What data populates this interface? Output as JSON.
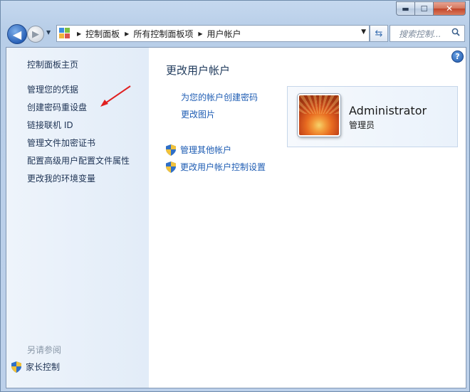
{
  "window": {
    "title": "",
    "controls": {
      "minimize": "▬",
      "maximize": "☐",
      "close": "✕"
    }
  },
  "nav": {
    "back_glyph": "◀",
    "forward_glyph": "▶",
    "breadcrumbs": [
      "控制面板",
      "所有控制面板项",
      "用户帐户"
    ],
    "search_placeholder": "搜索控制..."
  },
  "sidebar": {
    "home": "控制面板主页",
    "items": [
      "管理您的凭据",
      "创建密码重设盘",
      "链接联机 ID",
      "管理文件加密证书",
      "配置高级用户配置文件属性",
      "更改我的环境变量"
    ],
    "see_also_heading": "另请参阅",
    "see_also_items": [
      "家长控制"
    ]
  },
  "main": {
    "title": "更改用户帐户",
    "tasks": [
      "为您的帐户创建密码",
      "更改图片"
    ],
    "shield_tasks": [
      "管理其他帐户",
      "更改用户帐户控制设置"
    ],
    "help_glyph": "?"
  },
  "user": {
    "name": "Administrator",
    "role": "管理员"
  },
  "colors": {
    "link": "#1e5cb3",
    "annotation_arrow": "#e02020"
  }
}
